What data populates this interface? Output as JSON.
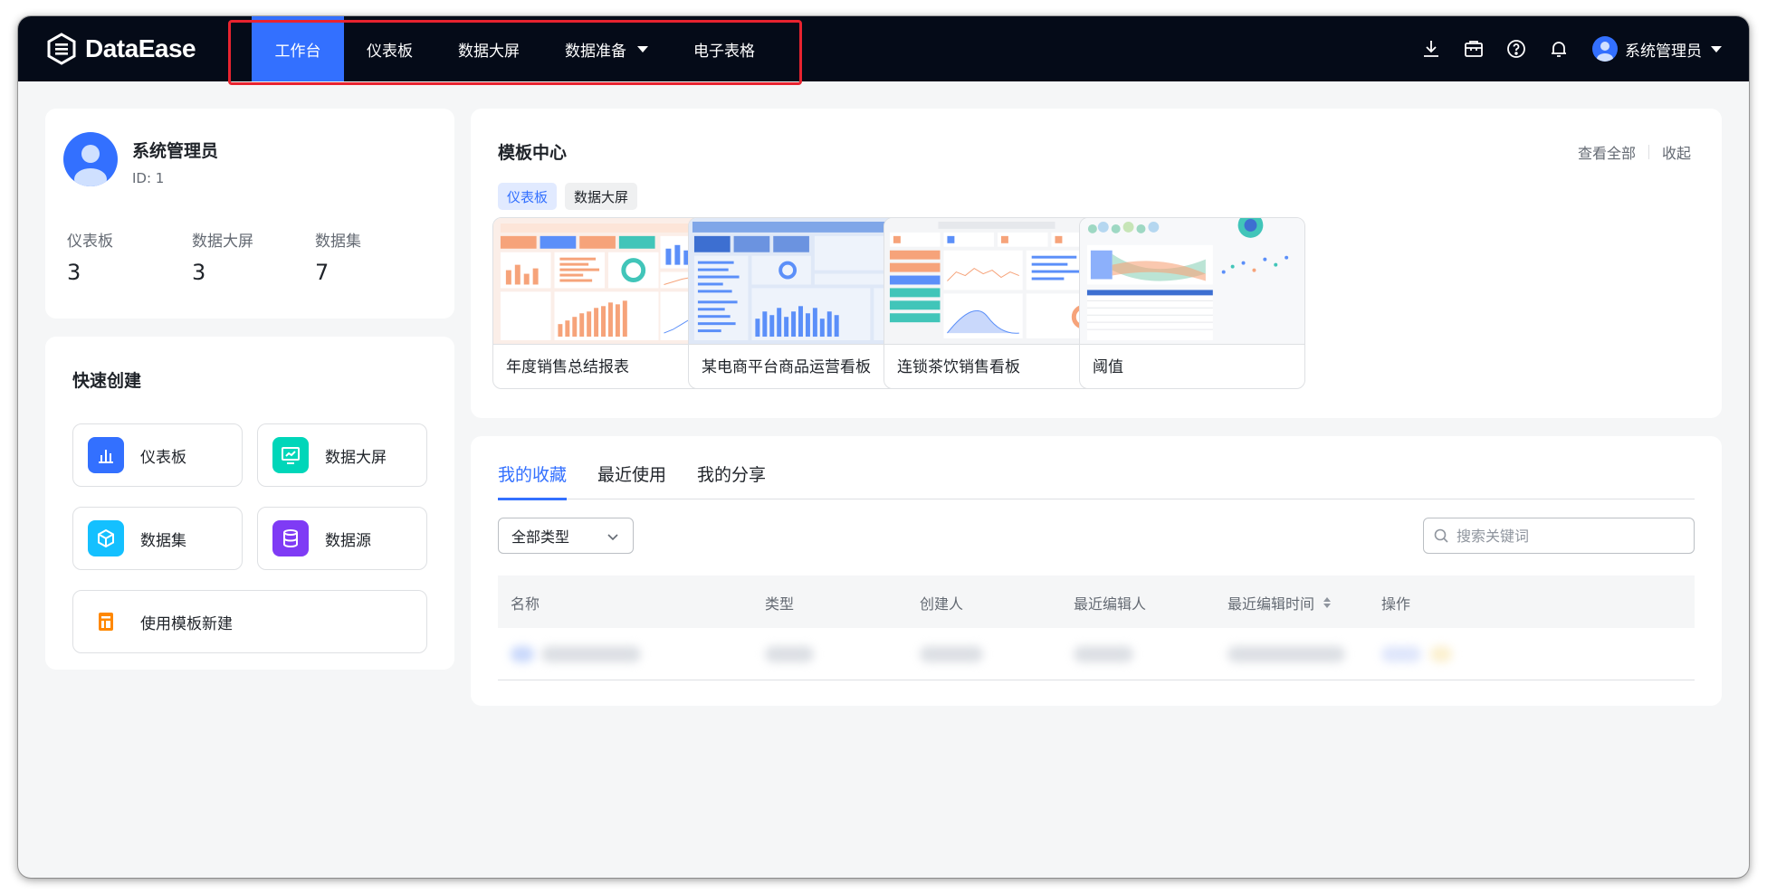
{
  "app": {
    "brand": "DataEase",
    "nav": [
      {
        "label": "工作台",
        "active": true
      },
      {
        "label": "仪表板"
      },
      {
        "label": "数据大屏"
      },
      {
        "label": "数据准备",
        "has_dropdown": true
      },
      {
        "label": "电子表格"
      }
    ],
    "toolbar_icons": [
      "download-icon",
      "toolbox-icon",
      "help-icon",
      "bell-icon"
    ],
    "user_name": "系统管理员",
    "accent_color": "#3370ff",
    "nav_bg_color": "#050b18",
    "highlight_color": "#e8232f"
  },
  "profile": {
    "name": "系统管理员",
    "id_text": "ID: 1",
    "stats": [
      {
        "label": "仪表板",
        "value": "3"
      },
      {
        "label": "数据大屏",
        "value": "3"
      },
      {
        "label": "数据集",
        "value": "7"
      }
    ]
  },
  "quick_create": {
    "title": "快速创建",
    "items": [
      {
        "label": "仪表板",
        "icon": "bar-chart-icon",
        "color": "#3370ff"
      },
      {
        "label": "数据大屏",
        "icon": "monitor-icon",
        "color": "#00d6b9"
      },
      {
        "label": "数据集",
        "icon": "cube-icon",
        "color": "#14c0ff"
      },
      {
        "label": "数据源",
        "icon": "database-icon",
        "color": "#7f3bf5"
      },
      {
        "label": "使用模板新建",
        "icon": "template-icon",
        "color": "#ff8800"
      }
    ]
  },
  "template_center": {
    "title": "模板中心",
    "view_all": "查看全部",
    "collapse": "收起",
    "chips": [
      {
        "label": "仪表板",
        "active": true
      },
      {
        "label": "数据大屏",
        "active": false
      }
    ],
    "templates": [
      {
        "name": "年度销售总结报表"
      },
      {
        "name": "某电商平台商品运营看板"
      },
      {
        "name": "连锁茶饮销售看板"
      },
      {
        "name": "阈值"
      }
    ]
  },
  "resources": {
    "tabs": [
      {
        "label": "我的收藏",
        "active": true
      },
      {
        "label": "最近使用"
      },
      {
        "label": "我的分享"
      }
    ],
    "type_filter": "全部类型",
    "search_placeholder": "搜索关键词",
    "columns": [
      "名称",
      "类型",
      "创建人",
      "最近编辑人",
      "最近编辑时间",
      "操作"
    ]
  }
}
